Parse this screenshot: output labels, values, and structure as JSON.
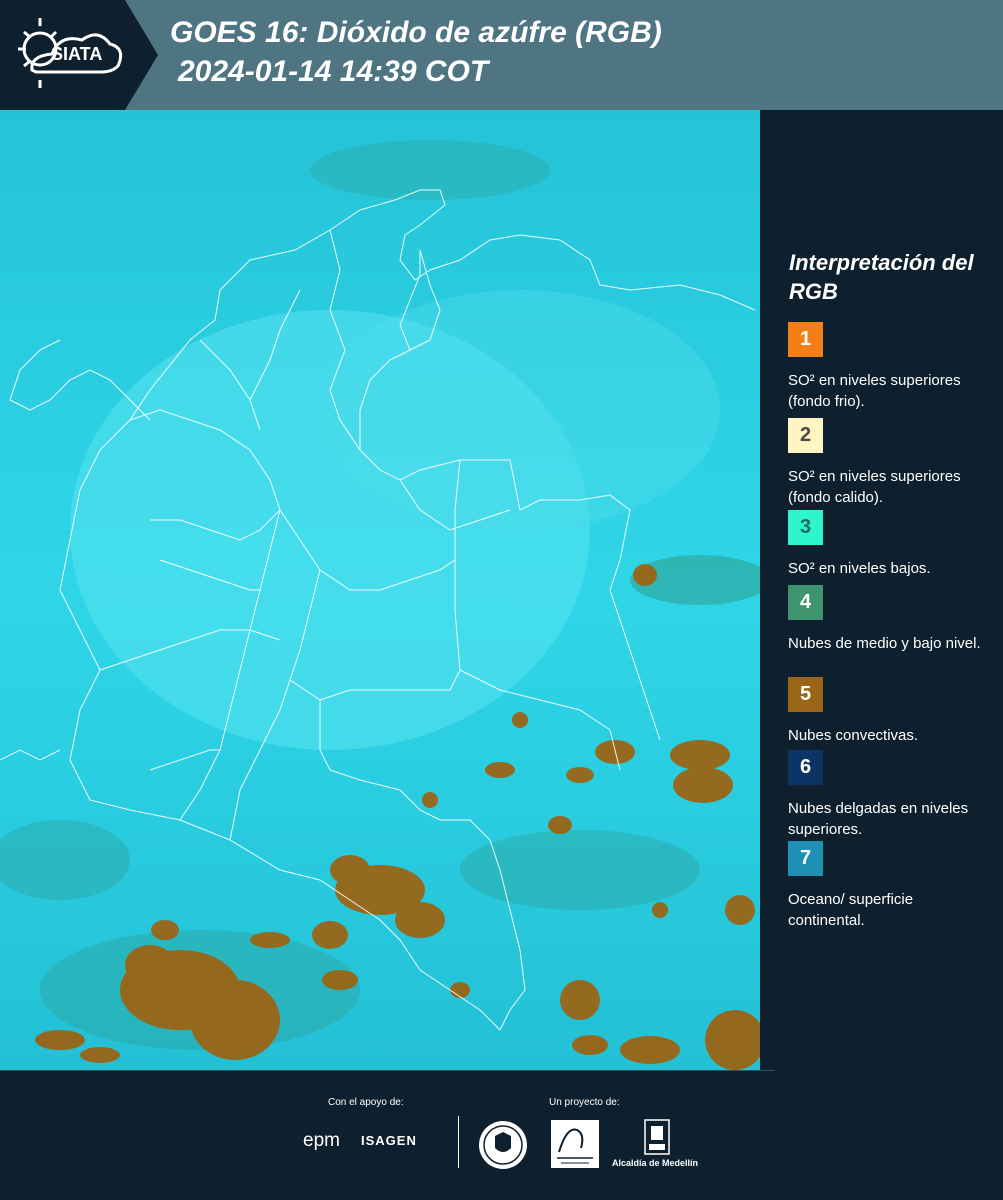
{
  "header": {
    "logo_text": "SIATA",
    "title": "GOES 16: Dióxido de azúfre (RGB)",
    "subtitle": "2024-01-14 14:39 COT"
  },
  "legend": {
    "title": "Interpretación del RGB",
    "items": [
      {
        "number": "1",
        "label": "SO² en niveles superiores (fondo frio).",
        "color": "#f57f17",
        "text_color": "#ffffff"
      },
      {
        "number": "2",
        "label": "SO² en niveles superiores (fondo calido).",
        "color": "#fff5c2",
        "text_color": "#4a4a4a"
      },
      {
        "number": "3",
        "label": "SO² en niveles bajos.",
        "color": "#2ff5cf",
        "text_color": "#1d6a5d"
      },
      {
        "number": "4",
        "label": "Nubes de medio y bajo nivel.",
        "color": "#3f9470",
        "text_color": "#ffffff"
      },
      {
        "number": "5",
        "label": "Nubes convectivas.",
        "color": "#9a6516",
        "text_color": "#ffffff"
      },
      {
        "number": "6",
        "label": "Nubes delgadas en niveles superiores.",
        "color": "#0c3466",
        "text_color": "#ffffff"
      },
      {
        "number": "7",
        "label": "Oceano/ superficie continental.",
        "color": "#1d90b3",
        "text_color": "#ffffff"
      }
    ]
  },
  "footer": {
    "support_label": "Con el apoyo de:",
    "project_label": "Un proyecto de:",
    "epm": "epm",
    "isagen": "ISAGEN",
    "alcaldia": "Alcaldía de Medellín"
  },
  "colors": {
    "header_bg": "#4f7482",
    "logo_bg": "#0e202d",
    "map_bg": "#27c9dc",
    "convective_cloud": "#9a6516",
    "border_line": "#ffffff"
  }
}
